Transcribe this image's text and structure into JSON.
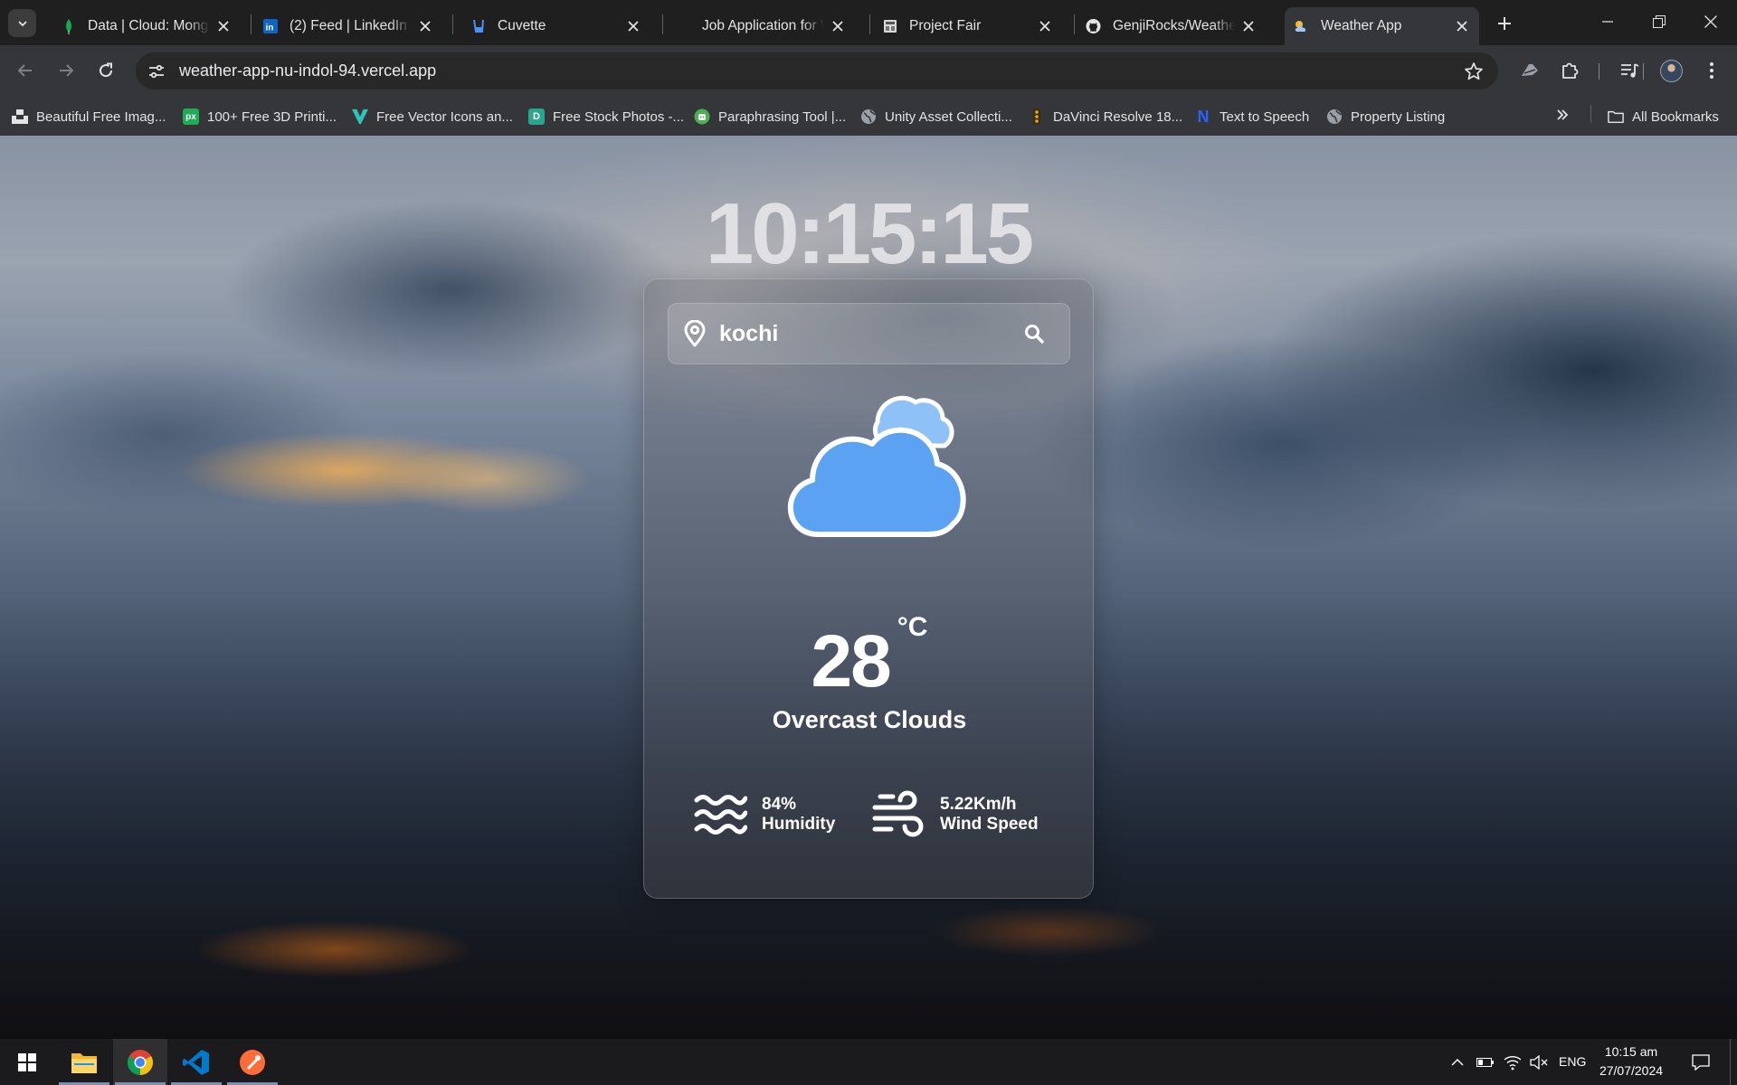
{
  "browser": {
    "tabs": [
      {
        "title": "Data | Cloud: MongoDB Cloud",
        "favicon": "mongodb-leaf-icon",
        "active": false
      },
      {
        "title": "(2) Feed | LinkedIn",
        "favicon": "linkedin-icon",
        "active": false
      },
      {
        "title": "Cuvette",
        "favicon": "cuvette-icon",
        "active": false
      },
      {
        "title": "Job Application for Web Developer",
        "favicon": "none",
        "active": false
      },
      {
        "title": "Project Fair",
        "favicon": "project-fair-icon",
        "active": false
      },
      {
        "title": "GenjiRocks/Weather-App",
        "favicon": "github-icon",
        "active": false
      },
      {
        "title": "Weather App",
        "favicon": "weather-app-icon",
        "active": true
      }
    ],
    "url": "weather-app-nu-indol-94.vercel.app",
    "bookmarks": [
      {
        "label": "Beautiful Free Imag...",
        "icon": "unsplash-icon"
      },
      {
        "label": "100+ Free 3D Printi...",
        "icon": "px",
        "color": "#1fab57"
      },
      {
        "label": "Free Vector Icons an...",
        "icon": "vecteezy-icon",
        "color": "#2ec4b6"
      },
      {
        "label": "Free Stock Photos -...",
        "icon": "D",
        "color": "#2ca58d"
      },
      {
        "label": "Paraphrasing Tool |...",
        "icon": "quillbot-icon",
        "color": "#4caf50"
      },
      {
        "label": "Unity Asset Collecti...",
        "icon": "globe-icon"
      },
      {
        "label": "DaVinci Resolve 18...",
        "icon": "davinci-icon"
      },
      {
        "label": "Text to Speech",
        "icon": "N",
        "color": "#2962ff"
      },
      {
        "label": "Property Listing",
        "icon": "globe-icon"
      }
    ],
    "all_bookmarks_label": "All Bookmarks"
  },
  "weather": {
    "clock": "10:15:15",
    "search_value": "kochi",
    "condition_icon": "cloud-icon",
    "temperature": "28",
    "unit": "°C",
    "description": "Overcast Clouds",
    "humidity_value": "84%",
    "humidity_label": "Humidity",
    "wind_value": "5.22Km/h",
    "wind_label": "Wind Speed",
    "cloud_color": "#5ba3f2",
    "cloud_back_color": "#8ec1f7"
  },
  "taskbar": {
    "apps": [
      "file-explorer-icon",
      "chrome-icon",
      "vscode-icon",
      "postman-icon"
    ],
    "language": "ENG",
    "time": "10:15 am",
    "date": "27/07/2024"
  }
}
